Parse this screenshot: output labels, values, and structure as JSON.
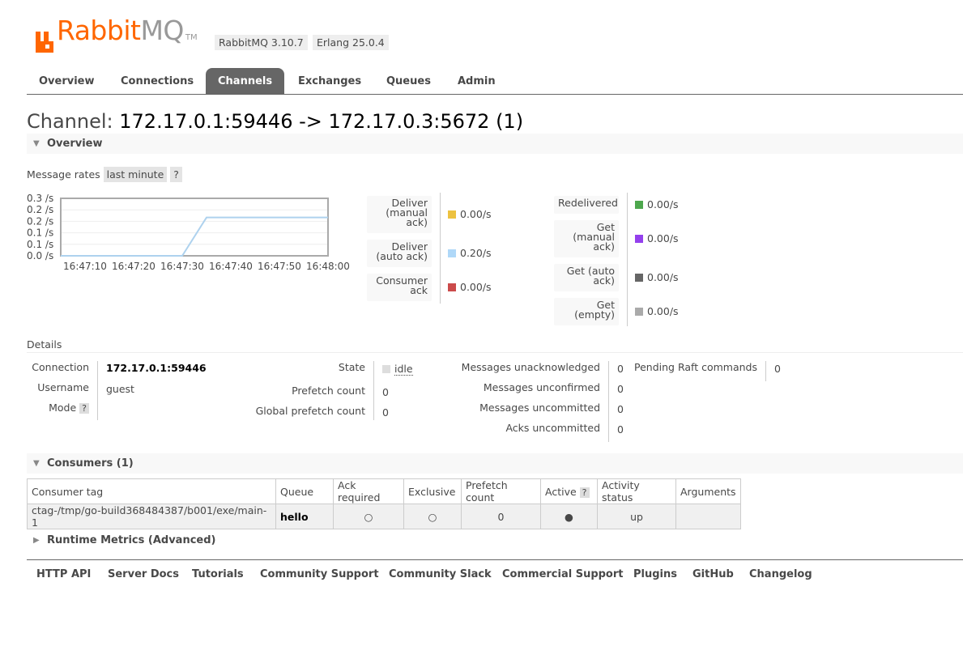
{
  "header": {
    "logo_main": "Rabbit",
    "logo_mq": "MQ",
    "logo_tm": "TM",
    "version": "RabbitMQ 3.10.7",
    "erlang": "Erlang 25.0.4",
    "brand_color": "#ff6600"
  },
  "nav": {
    "tabs": [
      {
        "label": "Overview"
      },
      {
        "label": "Connections"
      },
      {
        "label": "Channels",
        "active": true
      },
      {
        "label": "Exchanges"
      },
      {
        "label": "Queues"
      },
      {
        "label": "Admin"
      }
    ]
  },
  "page": {
    "title_prefix": "Channel:",
    "title_name": "172.17.0.1:59446 -> 172.17.0.3:5672 (1)"
  },
  "overview": {
    "heading": "Overview",
    "rates_label": "Message rates",
    "rates_period": "last minute",
    "help": "?"
  },
  "chart_data": {
    "type": "line",
    "x": [
      "16:47:10",
      "16:47:20",
      "16:47:30",
      "16:47:40",
      "16:47:50",
      "16:48:00"
    ],
    "y_ticks": [
      "0.3 /s",
      "0.2 /s",
      "0.2 /s",
      "0.1 /s",
      "0.1 /s",
      "0.0 /s"
    ],
    "ylim": [
      0,
      0.3
    ],
    "series": [
      {
        "name": "Deliver (auto ack)",
        "color": "#aed2ee",
        "points": [
          [
            "16:47:05",
            0
          ],
          [
            "16:47:30",
            0
          ],
          [
            "16:47:35",
            0.2
          ],
          [
            "16:48:00",
            0.2
          ]
        ]
      }
    ]
  },
  "rates_left": [
    {
      "label": "Deliver\n(manual\nack)",
      "value": "0.00/s",
      "color": "#edc240"
    },
    {
      "label": "Deliver\n(auto ack)",
      "value": "0.20/s",
      "color": "#afd8f8"
    },
    {
      "label": "Consumer\nack",
      "value": "0.00/s",
      "color": "#cb4b4b"
    }
  ],
  "rates_right": [
    {
      "label": "Redelivered",
      "value": "0.00/s",
      "color": "#4da74d"
    },
    {
      "label": "Get\n(manual\nack)",
      "value": "0.00/s",
      "color": "#9440ed"
    },
    {
      "label": "Get (auto\nack)",
      "value": "0.00/s",
      "color": "#666666"
    },
    {
      "label": "Get\n(empty)",
      "value": "0.00/s",
      "color": "#aaaaaa"
    }
  ],
  "details": {
    "heading": "Details",
    "connection_label": "Connection",
    "connection": "172.17.0.1:59446",
    "username_label": "Username",
    "username": "guest",
    "mode_label": "Mode",
    "state_label": "State",
    "state": "idle",
    "prefetch_label": "Prefetch count",
    "prefetch": "0",
    "global_prefetch_label": "Global prefetch count",
    "global_prefetch": "0",
    "unacked_label": "Messages unacknowledged",
    "unacked": "0",
    "unconfirmed_label": "Messages unconfirmed",
    "unconfirmed": "0",
    "uncommitted_label": "Messages uncommitted",
    "uncommitted": "0",
    "acks_uncommitted_label": "Acks uncommitted",
    "acks_uncommitted": "0",
    "raft_label": "Pending Raft commands",
    "raft": "0"
  },
  "consumers": {
    "heading": "Consumers (1)",
    "columns": [
      "Consumer tag",
      "Queue",
      "Ack required",
      "Exclusive",
      "Prefetch count",
      "Active",
      "Activity status",
      "Arguments"
    ],
    "rows": [
      [
        "ctag-/tmp/go-build368484387/b001/exe/main-1",
        "hello",
        "○",
        "○",
        "0",
        "●",
        "up",
        ""
      ]
    ]
  },
  "runtime": {
    "heading": "Runtime Metrics (Advanced)"
  },
  "footer": {
    "links": [
      "HTTP API",
      "Server Docs",
      "Tutorials",
      "Community Support",
      "Community Slack",
      "Commercial Support",
      "Plugins",
      "GitHub",
      "Changelog"
    ]
  }
}
